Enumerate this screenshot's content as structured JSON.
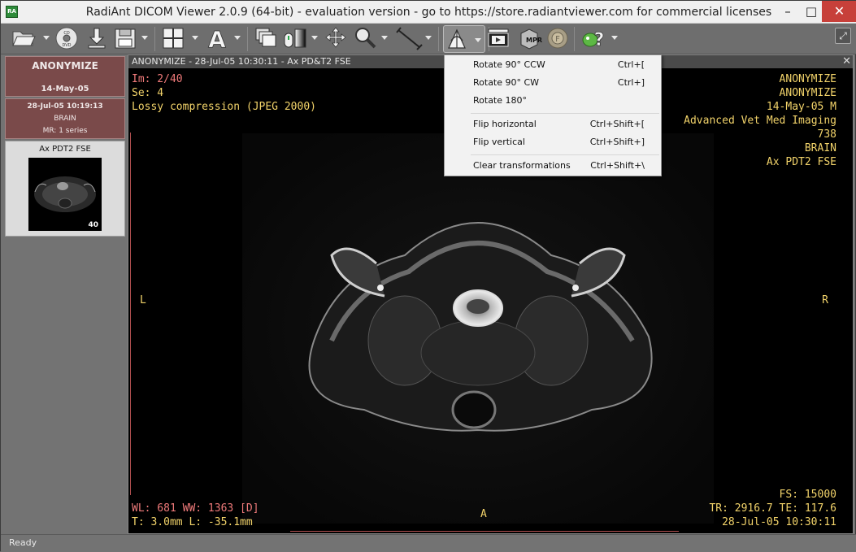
{
  "window": {
    "title": "RadiAnt DICOM Viewer 2.0.9 (64-bit) - evaluation version - go to https://store.radiantviewer.com for commercial licenses",
    "app_icon_text": "RA",
    "minimize": "–",
    "maximize": "□",
    "close": "✕"
  },
  "toolbar": {
    "buttons": [
      {
        "name": "open",
        "icon": "folder-icon"
      },
      {
        "name": "cd",
        "icon": "cd-dvd-icon"
      },
      {
        "name": "download",
        "icon": "download-icon"
      },
      {
        "name": "save",
        "icon": "floppy-icon"
      },
      {
        "name": "layout",
        "icon": "grid-layout-icon"
      },
      {
        "name": "annotations",
        "icon": "text-a-icon"
      },
      {
        "name": "series",
        "icon": "stack-icon"
      },
      {
        "name": "window-level",
        "icon": "mouse-contrast-icon"
      },
      {
        "name": "pan",
        "icon": "move-icon"
      },
      {
        "name": "zoom",
        "icon": "magnifier-icon"
      },
      {
        "name": "measure",
        "icon": "ruler-line-icon"
      },
      {
        "name": "transform",
        "icon": "rotate-flip-icon"
      },
      {
        "name": "cine",
        "icon": "film-icon"
      },
      {
        "name": "mpr",
        "icon": "mpr-cube-icon"
      },
      {
        "name": "fusion",
        "icon": "fusion-icon"
      },
      {
        "name": "help",
        "icon": "help-icon"
      }
    ],
    "fullscreen_icon": "⤢"
  },
  "patient": {
    "name": "ANONYMIZE",
    "date": "14-May-05"
  },
  "study": {
    "datetime": "28-Jul-05 10:19:13",
    "description": "BRAIN",
    "modality": "MR: 1 series"
  },
  "series": {
    "title": "Ax PDT2 FSE",
    "count": "40"
  },
  "viewer": {
    "header": "ANONYMIZE - 28-Jul-05 10:30:11 - Ax PD&T2 FSE",
    "close": "✕",
    "top_left": [
      "Im: 2/40",
      "Se: 4",
      "Lossy compression (JPEG 2000)"
    ],
    "top_right": [
      "ANONYMIZE",
      "ANONYMIZE",
      "14-May-05 M",
      "Advanced Vet Med Imaging",
      "738",
      "BRAIN",
      "Ax PDT2 FSE"
    ],
    "bottom_left": [
      "WL: 681 WW: 1363 [D]",
      "T: 3.0mm L: -35.1mm"
    ],
    "bottom_right": [
      "FS: 15000",
      "TR: 2916.7 TE: 117.6",
      "28-Jul-05 10:30:11"
    ],
    "orient_left": "L",
    "orient_right": "R",
    "orient_bottom": "A"
  },
  "menu": {
    "items": [
      {
        "label": "Rotate 90° CCW",
        "shortcut": "Ctrl+["
      },
      {
        "label": "Rotate 90° CW",
        "shortcut": "Ctrl+]"
      },
      {
        "label": "Rotate 180°",
        "shortcut": ""
      },
      {
        "label": "Flip horizontal",
        "shortcut": "Ctrl+Shift+["
      },
      {
        "label": "Flip vertical",
        "shortcut": "Ctrl+Shift+]"
      },
      {
        "label": "Clear transformations",
        "shortcut": "Ctrl+Shift+\\"
      }
    ]
  },
  "status": {
    "text": "Ready"
  }
}
